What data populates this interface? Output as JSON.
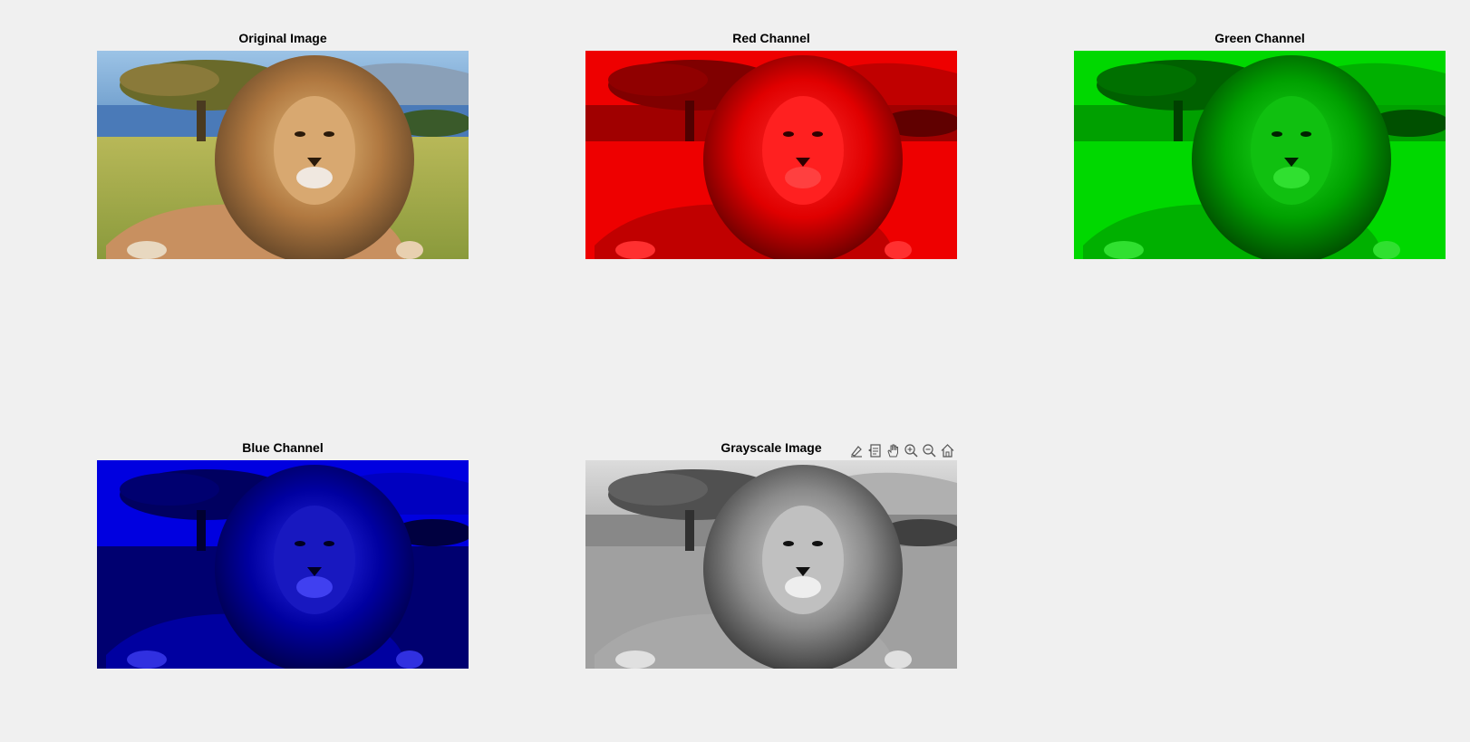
{
  "figure": {
    "background": "#f0f0f0",
    "subplots": [
      {
        "id": "original",
        "title": "Original Image",
        "channel": "rgb"
      },
      {
        "id": "red",
        "title": "Red Channel",
        "channel": "red",
        "tint": "#ff0000"
      },
      {
        "id": "green",
        "title": "Green Channel",
        "channel": "green",
        "tint": "#00dd00"
      },
      {
        "id": "blue",
        "title": "Blue Channel",
        "channel": "blue",
        "tint": "#0000ee"
      },
      {
        "id": "gray",
        "title": "Grayscale Image",
        "channel": "gray"
      }
    ]
  },
  "toolbar": {
    "buttons": [
      {
        "name": "brush-icon"
      },
      {
        "name": "data-tips-icon"
      },
      {
        "name": "pan-hand-icon"
      },
      {
        "name": "zoom-in-icon"
      },
      {
        "name": "zoom-out-icon"
      },
      {
        "name": "home-icon"
      }
    ]
  }
}
